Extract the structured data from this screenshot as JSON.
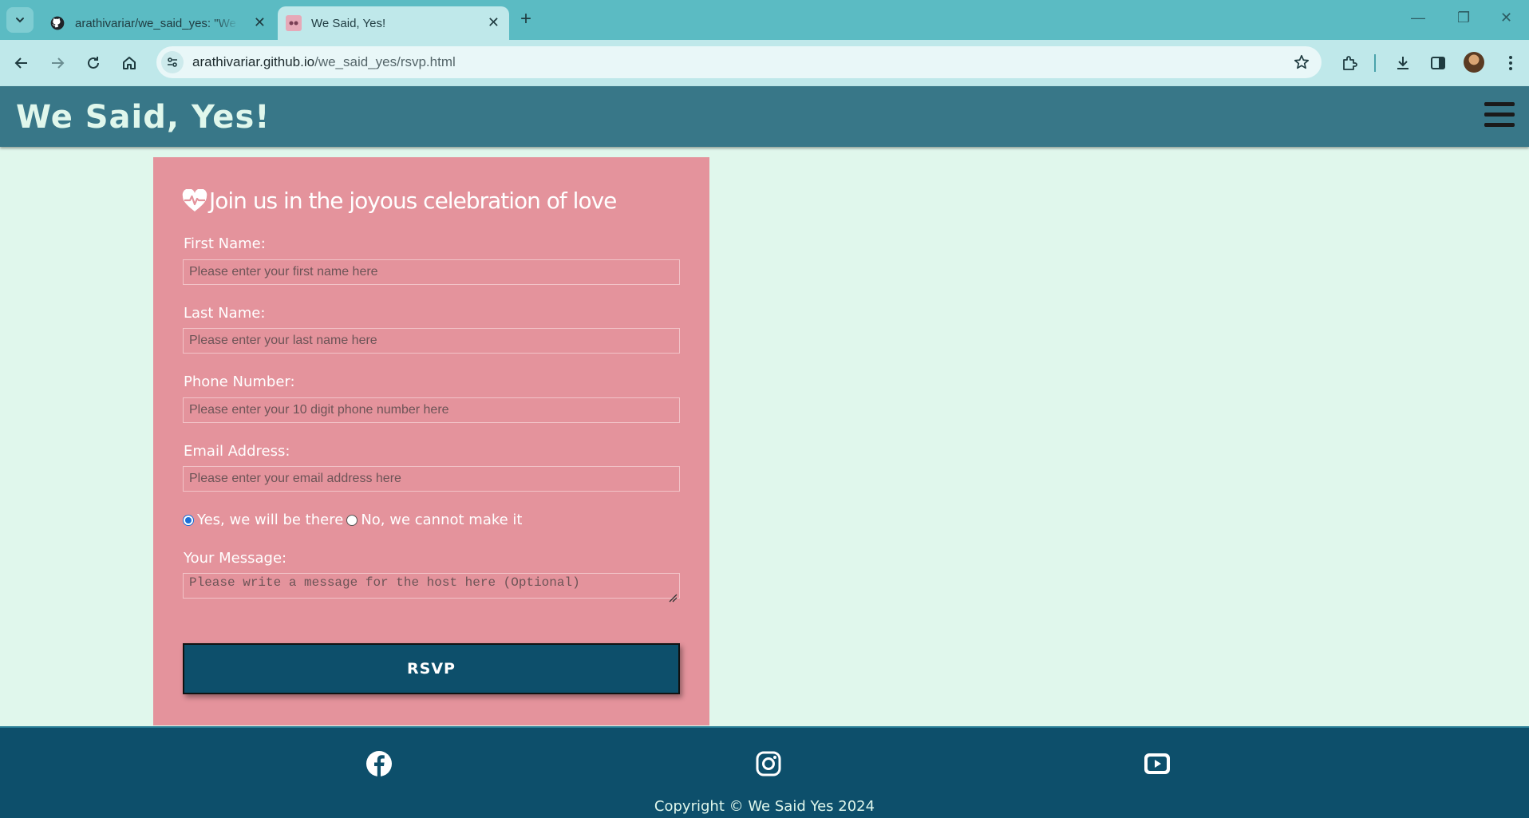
{
  "browser": {
    "tabs": [
      {
        "title": "arathivariar/we_said_yes: \"We Said, Yes!\"",
        "favicon": "github-icon",
        "active": false
      },
      {
        "title": "We Said, Yes!",
        "favicon": "site-favicon",
        "active": true
      }
    ],
    "url_host": "arathivariar.github.io",
    "url_path": "/we_said_yes/rsvp.html",
    "theme_color": "#5bbbc3"
  },
  "header": {
    "title": "We Said, Yes!",
    "menu_icon": "hamburger-menu-icon",
    "background": "#387788"
  },
  "form": {
    "heading": "Join us in the joyous celebration of love",
    "heading_icon": "heart-pulse-icon",
    "first_name": {
      "label": "First Name:",
      "placeholder": "Please enter your first name here"
    },
    "last_name": {
      "label": "Last Name:",
      "placeholder": "Please enter your last name here"
    },
    "phone": {
      "label": "Phone Number:",
      "placeholder": "Please enter your 10 digit phone number here"
    },
    "email": {
      "label": "Email Address:",
      "placeholder": "Please enter your email address here"
    },
    "attendance": [
      {
        "label": "Yes, we will be there",
        "checked": true
      },
      {
        "label": "No, we cannot make it",
        "checked": false
      }
    ],
    "message": {
      "label": "Your Message:",
      "placeholder": "Please write a message for the host here (Optional)"
    },
    "submit_label": "RSVP",
    "card_color": "#e4939c",
    "button_color": "#0d4f6b"
  },
  "footer": {
    "social": [
      "facebook-icon",
      "instagram-icon",
      "youtube-icon"
    ],
    "copyright": "Copyright © We Said Yes 2024",
    "background": "#0d4f6b"
  }
}
